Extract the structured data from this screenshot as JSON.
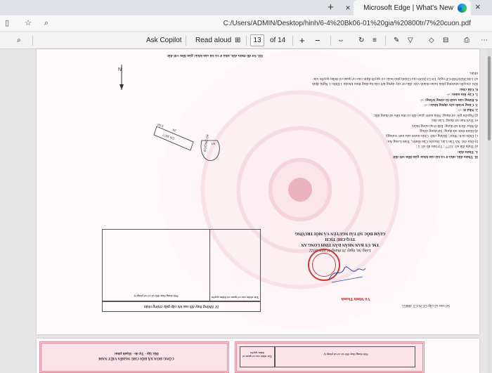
{
  "browser": {
    "active_tab_title": "Microsoft Edge | What's New",
    "url": "C:/Users/ADMIN/Desktop/hinh/6-4%20Bk06-01%20gia%20800tr/7%20cuon.pdf",
    "new_tab_symbol": "+",
    "close_symbol": "×"
  },
  "pdf_toolbar": {
    "read_aloud": "Read aloud",
    "ask_copilot": "Ask Copilot",
    "page_current": "13",
    "page_total": "of 14",
    "zoom_in": "+",
    "zoom_out": "−"
  },
  "document": {
    "section_header": "II. Thửa đất, nhà ở và tài sản khác gắn liền với đất",
    "section_header_dup": "III. Sơ đồ thửa đất, nhà ở và tài sản khác gắn liền với đất",
    "land_title": "1. Thửa đất:",
    "land_lines": [
      "a) Thửa đất số:   3377 ;   Tờ bản đồ số:   5 ;",
      "b) Địa chỉ:   Xã Tân Lân, Huyện Cần Đước, Tỉnh Long An;",
      "c) Diện tích:   96m²,  (Bằng chữ: Chín mươi sáu mét vuông);",
      "d) Hình thức sử dụng:   Sử dụng riêng;",
      "đ) Mục đích sử dụng:   Đất ở tại nông thôn;",
      "e) Thời hạn sử dụng:   Lâu dài;",
      "g) Nguồn gốc sử dụng:   Nhà nước giao đất có thu tiền sử dụng đất;"
    ],
    "house_line": "2. Nhà ở: -/-",
    "construction_line": "3. Công trình xây dựng khác: -/-",
    "forest_line": "4. Rừng sản xuất là rừng trồng: -/-",
    "perennial_line": "5. Cây lâu năm: -/-",
    "note_title": "6. Ghi chú:",
    "note_text": "Khi chuyển nhượng phải hoàn thành việc đấu tư xây dựng kết cấu hạ tầng theo khoản 1 Điều 1 Nghị định số 148/2020/NĐ-CP ngày 18/12/2020 của Chính phủ hoặc có quyết định của cơ quan có thẩm quyền xác nhận.",
    "date_line": "Long An, ngày 16 tháng 01 năm 2022",
    "issuer_1": "TM. ỦY BAN NHÂN DÂN TỈNH LONG AN",
    "issuer_2": "TUQ.CHỦ TỊCH",
    "issuer_3": "GIÁM ĐỐC SỞ TÀI NGUYÊN VÀ MÔI TRƯỜNG",
    "signer_name": "Võ Minh Thành",
    "registry_line": "Số vào sổ cấp GCN:CT 48855",
    "changes_table_title": "IV. Những thay đổi sau khi cấp giấy chứng nhận",
    "changes_col_1": "Nội dung thay đổi và cơ sở pháp lý",
    "changes_col_2": "Xác nhận của cơ quan có thẩm quyền",
    "map_labels": [
      "ĐƯỜNG D4",
      "LK",
      "CN 3377",
      "24",
      "5.50"
    ],
    "page2_left_title": "CỘNG HÒA XÃ HỘI CHỦ NGHĨA VIỆT NAM",
    "page2_left_sub": "Độc lập - Tự do - Hạnh phúc",
    "page2_right_col1": "Nội dung thay đổi và cơ sở pháp lý",
    "page2_right_col2": "Xác nhận của cơ quan có thẩm quyền"
  }
}
